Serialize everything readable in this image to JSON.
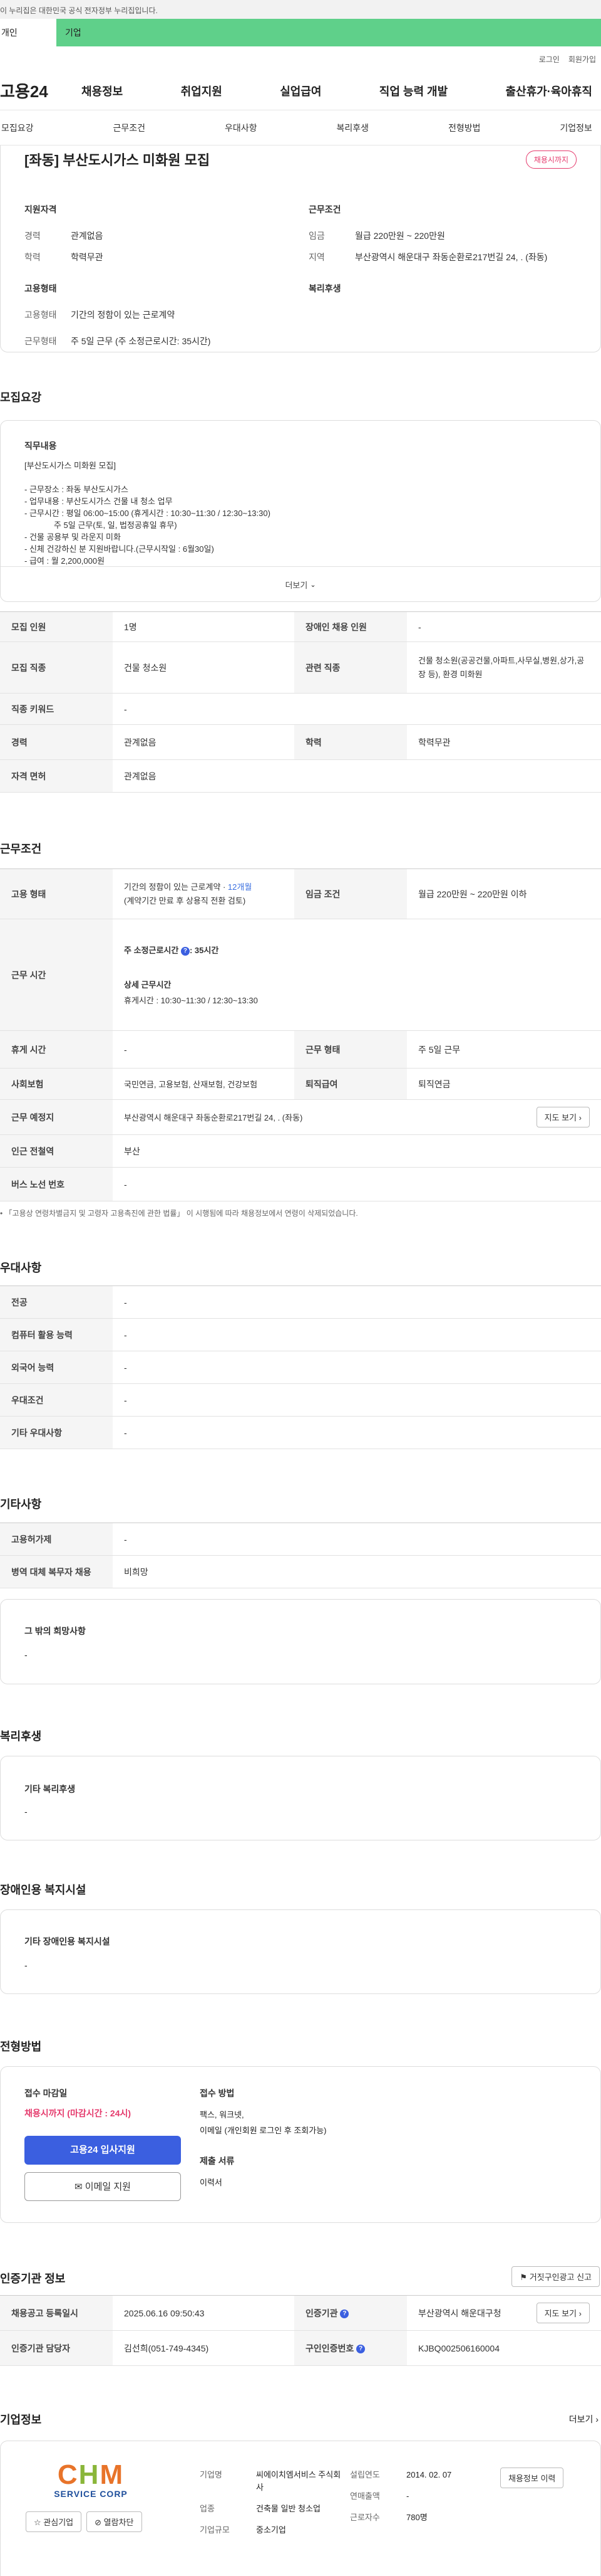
{
  "gov_bar": "이 누리집은 대한민국 공식 전자정부 누리집입니다.",
  "top_tabs": {
    "personal": "개인",
    "business": "기업"
  },
  "util": {
    "login": "로그인",
    "join": "회원가입"
  },
  "logo": "고용24",
  "gnb": [
    "채용정보",
    "취업지원",
    "실업급여",
    "직업 능력 개발",
    "출산휴가·육아휴직"
  ],
  "subnav": [
    "모집요강",
    "근무조건",
    "우대사항",
    "복리후생",
    "전형방법",
    "기업정보"
  ],
  "job": {
    "title": "[좌동] 부산도시가스 미화원 모집",
    "badge": "채용시까지",
    "qual_label": "지원자격",
    "career_k": "경력",
    "career_v": "관계없음",
    "edu_k": "학력",
    "edu_v": "학력무관",
    "cond_label": "근무조건",
    "wage_k": "임금",
    "wage_v": "월급 220만원 ~ 220만원",
    "region_k": "지역",
    "region_v": "부산광역시 해운대구 좌동순환로217번길 24, . (좌동)",
    "emp_label": "고용형태",
    "emptype_k": "고용형태",
    "emptype_v": "기간의 정함이 있는 근로계약",
    "worktype_k": "근무형태",
    "worktype_v": "주 5일 근무 (주 소정근로시간: 35시간)",
    "welfare_label": "복리후생"
  },
  "recruit": {
    "heading": "모집요강",
    "duty_label": "직무내용",
    "lines": [
      "[부산도시가스 미화원 모집]",
      "",
      "- 근무장소 : 좌동 부산도시가스",
      "- 업무내용 : 부산도시가스 건물 내 청소 업무",
      "- 근무시간 : 평일 06:00~15:00 (휴게시간 : 10:30~11:30 / 12:30~13:30)",
      "             주 5일 근무(토, 일, 법정공휴일 휴무)",
      "- 건물 공용부 및 라운지 미화",
      "- 신체 건강하신 분 지원바랍니다.(근무시작일 : 6월30일)",
      "- 급여 : 월 2,200,000원"
    ],
    "more": "더보기",
    "rows": [
      {
        "k1": "모집 인원",
        "v1": "1명",
        "k2": "장애인 채용 인원",
        "v2": "-"
      },
      {
        "k1": "모집 직종",
        "v1": "건물 청소원",
        "k2": "관련 직종",
        "v2": "건물 청소원(공공건물,아파트,사무실,병원,상가,공장 등), 환경 미화원"
      },
      {
        "k1": "직종 키워드",
        "v1": "-"
      },
      {
        "k1": "경력",
        "v1": "관계없음",
        "k2": "학력",
        "v2": "학력무관"
      },
      {
        "k1": "자격 면허",
        "v1": "관계없음"
      }
    ]
  },
  "workcond": {
    "heading": "근무조건",
    "emp_k": "고용 형태",
    "emp_v1": "기간의 정함이 있는 근로계약 · ",
    "emp_months": "12개월",
    "emp_v2": "(계약기간 만료 후 상용직 전환 검토)",
    "wage_k": "임금 조건",
    "wage_v": "월급 220만원 ~ 220만원 이하",
    "time_k": "근무 시간",
    "time_weekly": "주 소정근로시간",
    "time_weekly_v": ": 35시간",
    "time_detail": "상세 근무시간",
    "time_rest": "휴게시간 : 10:30~11:30 / 12:30~13:30",
    "rest_k": "휴게 시간",
    "rest_v": "-",
    "form_k": "근무 형태",
    "form_v": "주 5일 근무",
    "ins_k": "사회보험",
    "ins_v": "국민연금, 고용보험, 산재보험, 건강보험",
    "ret_k": "퇴직급여",
    "ret_v": "퇴직연금",
    "place_k": "근무 예정지",
    "place_v": "부산광역시 해운대구 좌동순환로217번길 24, . (좌동)",
    "map_btn": "지도 보기",
    "sub_k": "인근 전철역",
    "sub_v": "부산",
    "bus_k": "버스 노선 번호",
    "bus_v": "-",
    "note": "「고용상 연령차별금지 및 고령자 고용촉진에 관한 법률」 이 시행됨에 따라 채용정보에서 연령이 삭제되었습니다."
  },
  "pref": {
    "heading": "우대사항",
    "rows": [
      {
        "k": "전공",
        "v": "-"
      },
      {
        "k": "컴퓨터 활용 능력",
        "v": "-"
      },
      {
        "k": "외국어 능력",
        "v": "-"
      },
      {
        "k": "우대조건",
        "v": "-"
      },
      {
        "k": "기타 우대사항",
        "v": "-"
      }
    ]
  },
  "etc": {
    "heading": "기타사항",
    "rows": [
      {
        "k": "고용허가제",
        "v": "-"
      },
      {
        "k": "병역 대체 복무자 채용",
        "v": "비희망"
      }
    ],
    "hope_label": "그 밖의 희망사항",
    "hope_v": "-"
  },
  "welfare": {
    "heading": "복리후생",
    "label": "기타 복리후생",
    "v": "-"
  },
  "disab": {
    "heading": "장애인용 복지시설",
    "label": "기타 장애인용 복지시설",
    "v": "-"
  },
  "screening": {
    "heading": "전형방법",
    "deadline_label": "접수 마감일",
    "deadline_v": "채용시까지 (마감시간 : 24시)",
    "apply_btn": "고용24 입사지원",
    "email_btn": "이메일 지원",
    "method_label": "접수 방법",
    "method_v1": "팩스, 워크넷,",
    "method_v2": "이메일 (개인회원 로그인 후 조회가능)",
    "docs_label": "제출 서류",
    "docs_v": "이력서"
  },
  "cert": {
    "heading": "인증기관 정보",
    "report_btn": "거짓구인광고 신고",
    "reg_k": "채용공고 등록일시",
    "reg_v": "2025.06.16 09:50:43",
    "org_k": "인증기관",
    "org_v": "부산광역시 해운대구청",
    "map_btn": "지도 보기",
    "mgr_k": "인증기관 담당자",
    "mgr_v": "김선희(051-749-4345)",
    "no_k": "구인인증번호",
    "no_v": "KJBQ002506160004"
  },
  "company": {
    "heading": "기업정보",
    "more": "더보기",
    "logo_text": "CHM",
    "logo_sub": "SERVICE CORP",
    "fav_btn": "관심기업",
    "block_btn": "열람차단",
    "name_k": "기업명",
    "name_v": "씨에이치엠서비스 주식회사",
    "est_k": "설립연도",
    "est_v": "2014. 02. 07",
    "info_btn": "채용정보 이력",
    "sales_k": "연매출액",
    "sales_v": "-",
    "ind_k": "업종",
    "ind_v": "건축물 일반 청소업",
    "emp_k": "근로자수",
    "emp_v": "780명",
    "size_k": "기업규모",
    "size_v": "중소기업"
  }
}
